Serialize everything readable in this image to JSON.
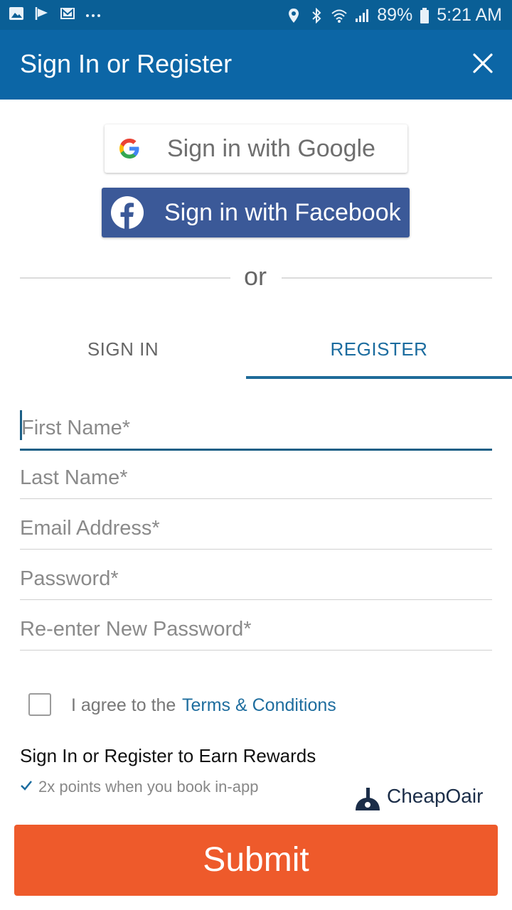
{
  "status_bar": {
    "battery": "89%",
    "time": "5:21 AM",
    "left_icons": [
      "image-icon",
      "check-flag-icon",
      "mail-icon",
      "more-dots-icon"
    ],
    "right_icons": [
      "location-icon",
      "bluetooth-icon",
      "wifi-icon",
      "signal-icon",
      "battery-icon"
    ]
  },
  "header": {
    "title": "Sign In or Register",
    "close_icon": "close-icon"
  },
  "social": {
    "google_label": "Sign in with Google",
    "facebook_label": "Sign in with Facebook"
  },
  "divider_text": "or",
  "tabs": [
    {
      "label": "SIGN IN",
      "active": false
    },
    {
      "label": "REGISTER",
      "active": true
    }
  ],
  "form": {
    "first_name": {
      "placeholder": "First Name*",
      "value": ""
    },
    "last_name": {
      "placeholder": "Last Name*",
      "value": ""
    },
    "email": {
      "placeholder": "Email Address*",
      "value": ""
    },
    "password": {
      "placeholder": "Password*",
      "value": ""
    },
    "reenter_password": {
      "placeholder": "Re-enter New Password*",
      "value": ""
    }
  },
  "terms": {
    "prefix": "I agree to the",
    "link": "Terms & Conditions",
    "checked": false
  },
  "rewards": {
    "title": "Sign In or Register to Earn Rewards",
    "item": "2x points when you book in-app",
    "brand": "CheapOair"
  },
  "submit_label": "Submit",
  "colors": {
    "status_bar": "#0a5f96",
    "app_bar": "#0c66a6",
    "facebook": "#3b5998",
    "accent": "#1b6c9f",
    "submit": "#ee5a2b"
  }
}
